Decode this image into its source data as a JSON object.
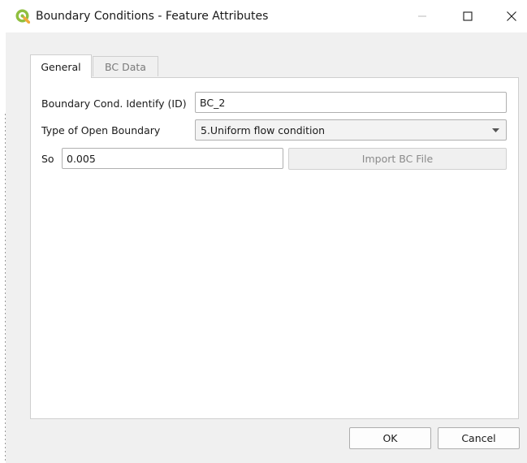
{
  "window": {
    "title": "Boundary Conditions - Feature Attributes",
    "icon": "qgis-icon",
    "controls": {
      "minimize_icon": "minimize-icon",
      "maximize_icon": "maximize-icon",
      "close_icon": "close-icon"
    }
  },
  "tabs": [
    {
      "label": "General",
      "selected": true
    },
    {
      "label": "BC Data",
      "selected": false
    }
  ],
  "form": {
    "id_label": "Boundary Cond. Identify (ID)",
    "id_value": "BC_2",
    "type_label": "Type of Open Boundary",
    "type_value": "5.Uniform flow condition",
    "so_label": "So",
    "so_value": "0.005",
    "import_button": "Import BC File"
  },
  "buttons": {
    "ok": "OK",
    "cancel": "Cancel"
  },
  "colors": {
    "qgis_green": "#8fbf3f",
    "window_bg": "#f0f0f0"
  }
}
